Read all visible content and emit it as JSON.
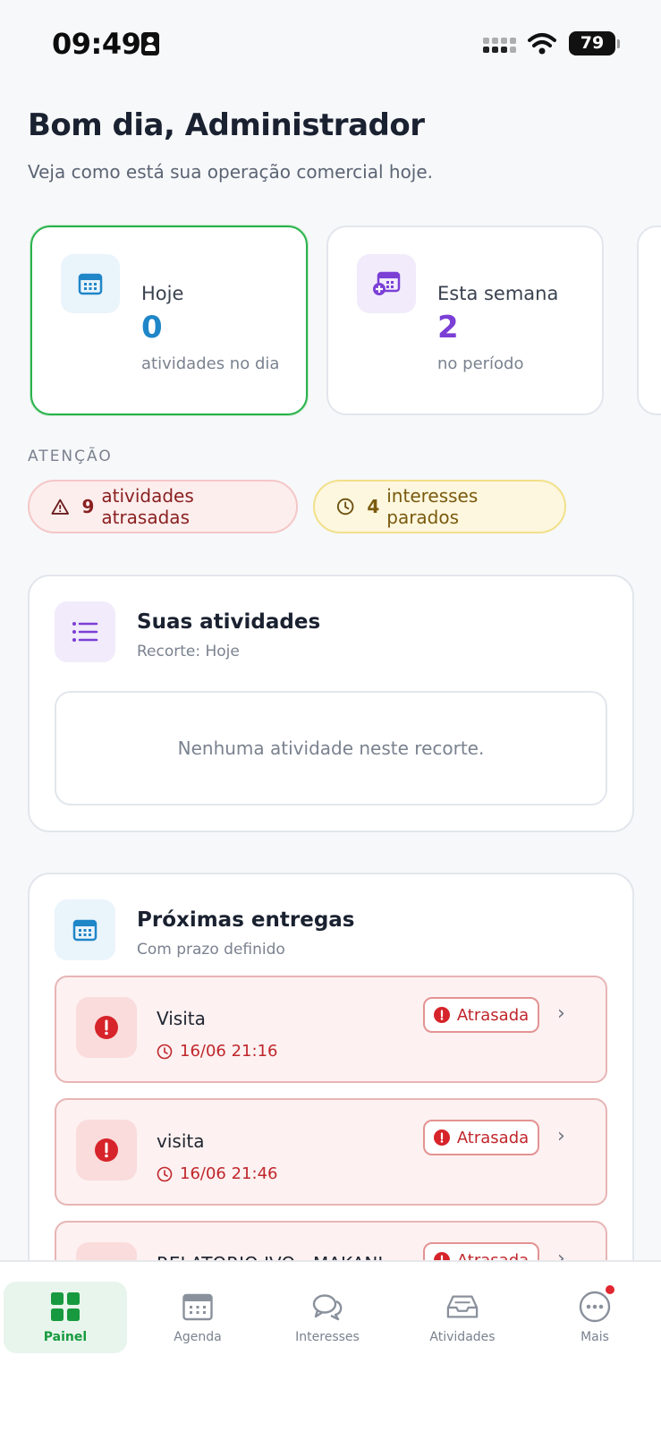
{
  "status_bar": {
    "time": "09:49",
    "battery": "79"
  },
  "header": {
    "greeting": "Bom dia, Administrador",
    "subtitle": "Veja como está sua operação comercial hoje."
  },
  "stats": [
    {
      "label": "Hoje",
      "value": "0",
      "caption": "atividades no dia",
      "icon": "calendar-icon",
      "color": "#1f86c8"
    },
    {
      "label": "Esta semana",
      "value": "2",
      "caption": "no período",
      "icon": "calendar-plus-icon",
      "color": "#7b3fd6"
    }
  ],
  "attention": {
    "label": "ATENÇÃO",
    "chips": [
      {
        "count": "9",
        "text": "atividades atrasadas",
        "icon": "warning-icon"
      },
      {
        "count": "4",
        "text": "interesses parados",
        "icon": "clock-icon"
      }
    ]
  },
  "activities_panel": {
    "title": "Suas atividades",
    "subtitle": "Recorte: Hoje",
    "empty_text": "Nenhuma atividade neste recorte.",
    "icon": "list-icon"
  },
  "deliveries_panel": {
    "title": "Próximas entregas",
    "subtitle": "Com prazo definido",
    "icon": "calendar-icon",
    "items": [
      {
        "title": "Visita",
        "date": "16/06 21:16",
        "badge": "Atrasada"
      },
      {
        "title": "visita",
        "date": "16/06 21:46",
        "badge": "Atrasada"
      },
      {
        "title": "RELATORIO IVO - MAKANI",
        "date": "",
        "badge": "Atrasada"
      }
    ]
  },
  "bottom_nav": [
    {
      "label": "Painel",
      "icon": "grid-icon",
      "active": true
    },
    {
      "label": "Agenda",
      "icon": "calendar-icon",
      "active": false
    },
    {
      "label": "Interesses",
      "icon": "chat-icon",
      "active": false
    },
    {
      "label": "Atividades",
      "icon": "inbox-icon",
      "active": false
    },
    {
      "label": "Mais",
      "icon": "more-icon",
      "active": false
    }
  ],
  "colors": {
    "accent_green": "#2ab24c",
    "danger_red": "#c0262b",
    "purple": "#7b3fd6",
    "blue": "#1f86c8"
  }
}
